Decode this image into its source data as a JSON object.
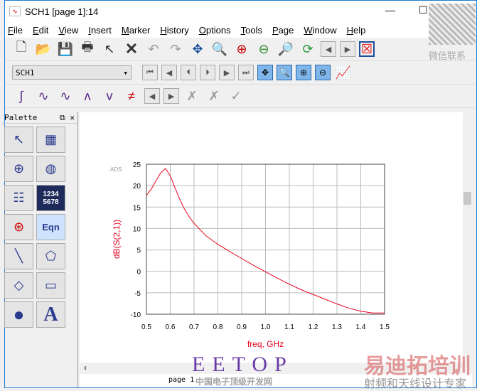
{
  "window": {
    "title": "SCH1 [page 1]:14",
    "icon": "waveform-icon",
    "minimize": "—",
    "maximize": "☐",
    "close": "✕"
  },
  "menu": [
    "File",
    "Edit",
    "View",
    "Insert",
    "Marker",
    "History",
    "Options",
    "Tools",
    "Page",
    "Window",
    "Help"
  ],
  "toolbar2": {
    "selector_value": "SCH1"
  },
  "palette": {
    "title": "Palette",
    "float": "⧉",
    "close": "✕",
    "eqn_label": "Eqn",
    "num_label": "1234\n5678",
    "text_label": "A"
  },
  "chart_data": {
    "type": "line",
    "xlabel": "freq, GHz",
    "ylabel": "dB(S(2,1))",
    "corner_label": "ADS",
    "xlim": [
      0.5,
      1.5
    ],
    "ylim": [
      -10,
      25
    ],
    "xticks": [
      "0.5",
      "0.6",
      "0.7",
      "0.8",
      "0.9",
      "1.0",
      "1.1",
      "1.2",
      "1.3",
      "1.4",
      "1.5"
    ],
    "yticks": [
      "25",
      "20",
      "15",
      "10",
      "5",
      "0",
      "-5",
      "-10"
    ],
    "grid": true,
    "color": "#e8001c",
    "series": [
      {
        "name": "dB(S(2,1))",
        "x": [
          0.5,
          0.52,
          0.54,
          0.56,
          0.58,
          0.6,
          0.62,
          0.64,
          0.66,
          0.68,
          0.7,
          0.75,
          0.8,
          0.85,
          0.9,
          0.95,
          1.0,
          1.05,
          1.1,
          1.15,
          1.2,
          1.25,
          1.3,
          1.35,
          1.4,
          1.45,
          1.5
        ],
        "y": [
          17.7,
          19.2,
          21.1,
          23,
          24,
          22.3,
          19.5,
          16.8,
          14.5,
          12.7,
          11.2,
          8.3,
          6.3,
          4.6,
          3.0,
          1.4,
          -0.1,
          -1.6,
          -3.0,
          -4.3,
          -5.4,
          -6.5,
          -7.6,
          -8.6,
          -9.3,
          -9.7,
          -9.7
        ]
      }
    ]
  },
  "tab": {
    "label": "page 1"
  },
  "watermarks": {
    "eetop": "EETOP",
    "eetop_sub": "中国电子顶级开发网",
    "brand": "易迪拓培训",
    "brand_sub": "射频和天线设计专家",
    "wechat": "微信联系"
  }
}
